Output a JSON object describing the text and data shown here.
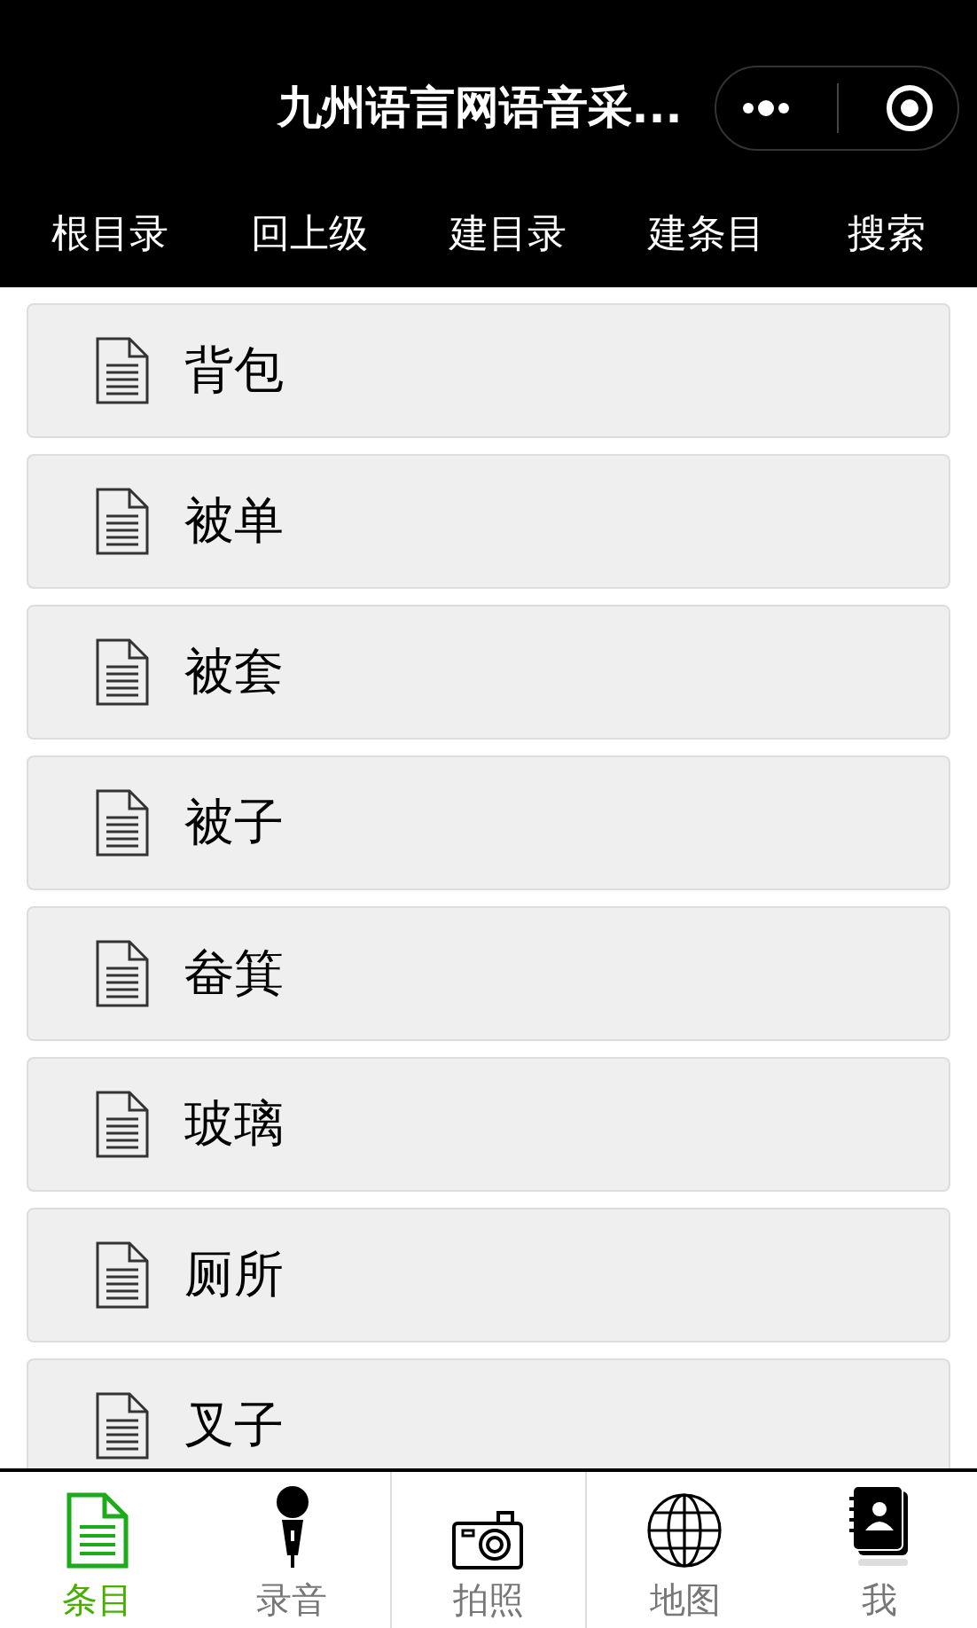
{
  "header": {
    "title": "九州语言网语音采..."
  },
  "toolbar": [
    "根目录",
    "回上级",
    "建目录",
    "建条目",
    "搜索"
  ],
  "items": [
    "背包",
    "被单",
    "被套",
    "被子",
    "畚箕",
    "玻璃",
    "厕所",
    "叉子"
  ],
  "tabbar": [
    {
      "label": "条目",
      "selected": true
    },
    {
      "label": "录音",
      "selected": false
    },
    {
      "label": "拍照",
      "selected": false
    },
    {
      "label": "地图",
      "selected": false
    },
    {
      "label": "我",
      "selected": false
    }
  ]
}
